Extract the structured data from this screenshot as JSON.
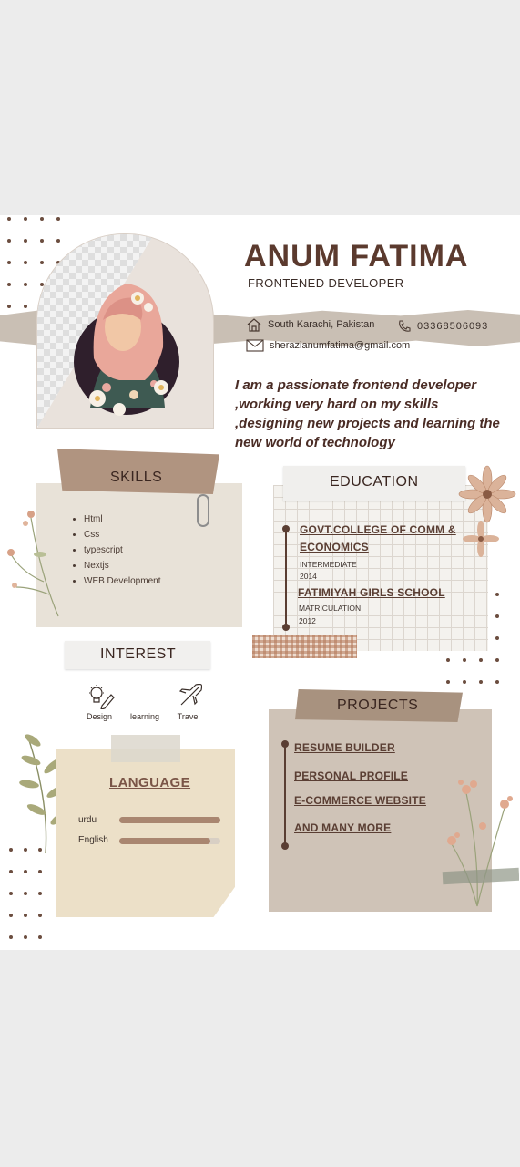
{
  "profile": {
    "name": "ANUM FATIMA",
    "role": "FRONTENED DEVELOPER",
    "address": "South Karachi, Pakistan",
    "phone": "03368506093",
    "email": "sherazianumfatima@gmail.com",
    "bio": "I am a passionate frontend developer ,working very hard on my skills ,designing new projects and learning the new world of technology"
  },
  "skills": {
    "title": "SKILLS",
    "items": [
      "Html",
      "Css",
      "typescript",
      "Nextjs",
      "WEB Development"
    ]
  },
  "education": {
    "title": "EDUCATION",
    "entries": [
      {
        "school": "GOVT.COLLEGE OF COMM & ECONOMICS",
        "level": "INTERMEDIATE",
        "year": "2014"
      },
      {
        "school": "FATIMIYAH GIRLS SCHOOL",
        "level": "MATRICULATION",
        "year": "2012"
      }
    ]
  },
  "interest": {
    "title": "INTEREST",
    "items": [
      {
        "label": "Design",
        "icon": "lightbulb-pencil-icon"
      },
      {
        "label": "learning",
        "icon": ""
      },
      {
        "label": "Travel",
        "icon": "airplane-icon"
      }
    ]
  },
  "language": {
    "title": "LANGUAGE",
    "items": [
      {
        "name": "urdu",
        "level": 1.0
      },
      {
        "name": "English",
        "level": 0.9
      }
    ]
  },
  "projects": {
    "title": "PROJECTS",
    "items": [
      "RESUME BUILDER",
      "PERSONAL PROFILE",
      "E-COMMERCE WEBSITE",
      "AND MANY MORE"
    ]
  },
  "colors": {
    "accent_brown": "#5b3a2e",
    "paper_beige": "#e8e2d8",
    "tape_brown": "#b09480",
    "band_grey": "#c9bfb4"
  }
}
